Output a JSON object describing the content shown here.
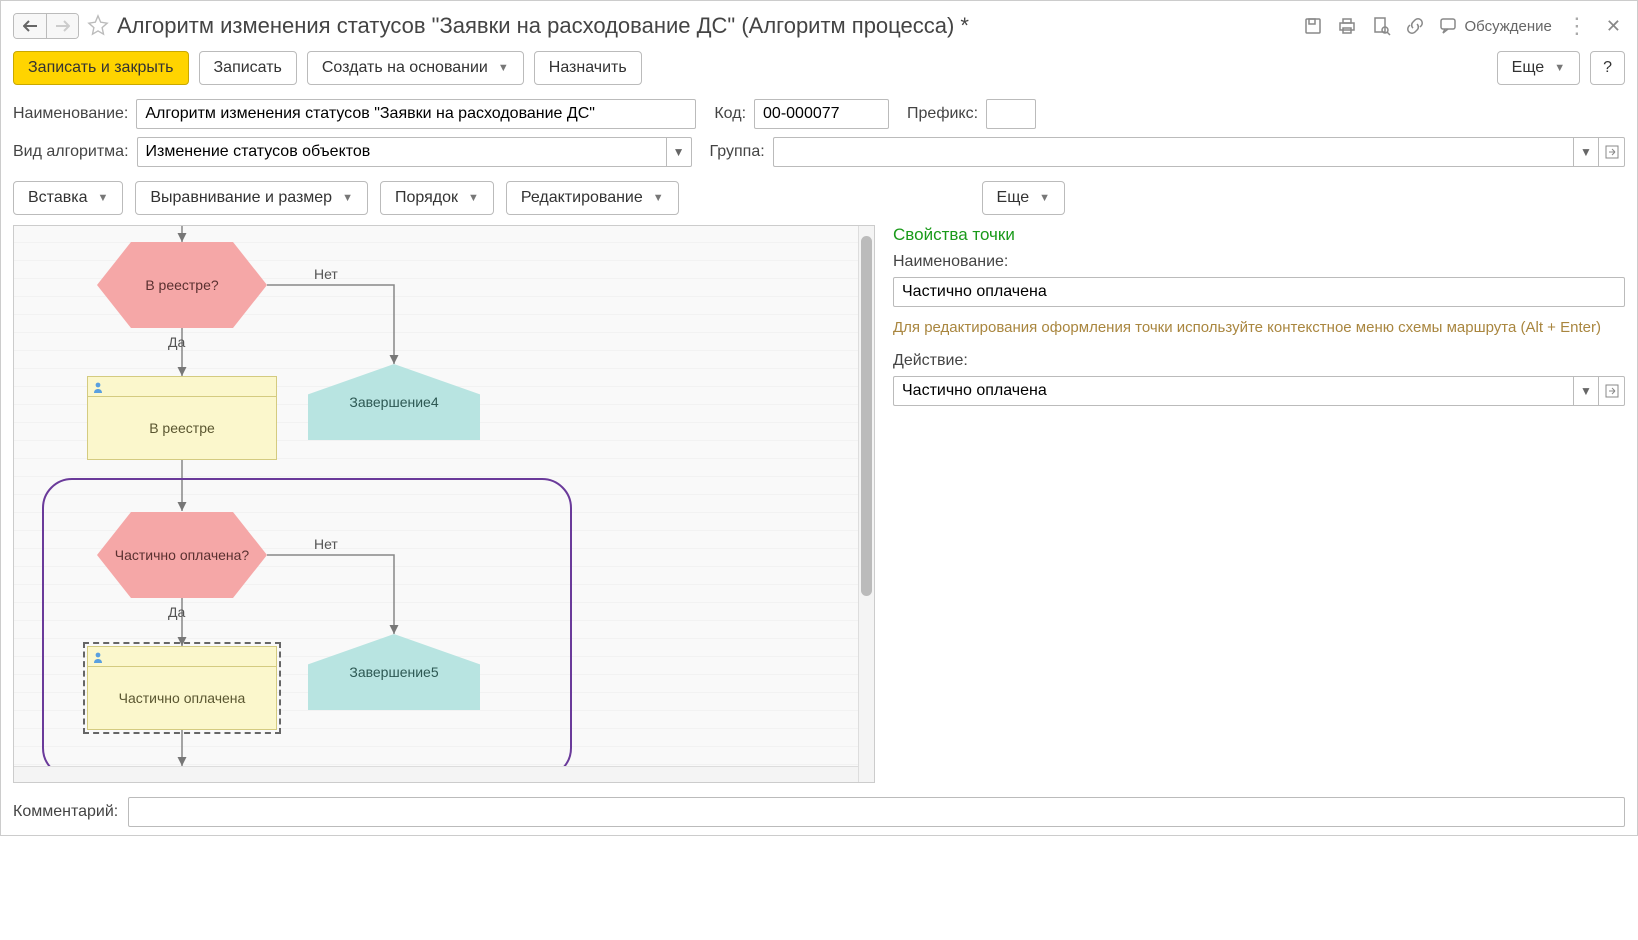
{
  "header": {
    "title": "Алгоритм изменения статусов \"Заявки на расходование ДС\" (Алгоритм процесса) *",
    "discuss_label": "Обсуждение"
  },
  "toolbar": {
    "save_close": "Записать и закрыть",
    "save": "Записать",
    "create_based": "Создать на основании",
    "assign": "Назначить",
    "more": "Еще",
    "help": "?"
  },
  "form": {
    "name_label": "Наименование:",
    "name_value": "Алгоритм изменения статусов \"Заявки на расходование ДС\"",
    "code_label": "Код:",
    "code_value": "00-000077",
    "prefix_label": "Префикс:",
    "prefix_value": "",
    "algo_type_label": "Вид алгоритма:",
    "algo_type_value": "Изменение статусов объектов",
    "group_label": "Группа:",
    "group_value": ""
  },
  "diagram_toolbar": {
    "insert": "Вставка",
    "align_size": "Выравнивание и размер",
    "order": "Порядок",
    "editing": "Редактирование",
    "more": "Еще"
  },
  "diagram": {
    "dec1": "В реестре?",
    "dec1_yes": "Да",
    "dec1_no": "Нет",
    "task1": "В реестре",
    "end1": "Завершение4",
    "dec2": "Частично оплачена?",
    "dec2_yes": "Да",
    "dec2_no": "Нет",
    "task2": "Частично оплачена",
    "end2": "Завершение5"
  },
  "side": {
    "title": "Свойства точки",
    "name_label": "Наименование:",
    "name_value": "Частично оплачена",
    "hint": "Для редактирования оформления точки используйте контекстное меню схемы маршрута (Alt + Enter)",
    "action_label": "Действие:",
    "action_value": "Частично оплачена"
  },
  "bottom": {
    "comment_label": "Комментарий:",
    "comment_value": ""
  }
}
